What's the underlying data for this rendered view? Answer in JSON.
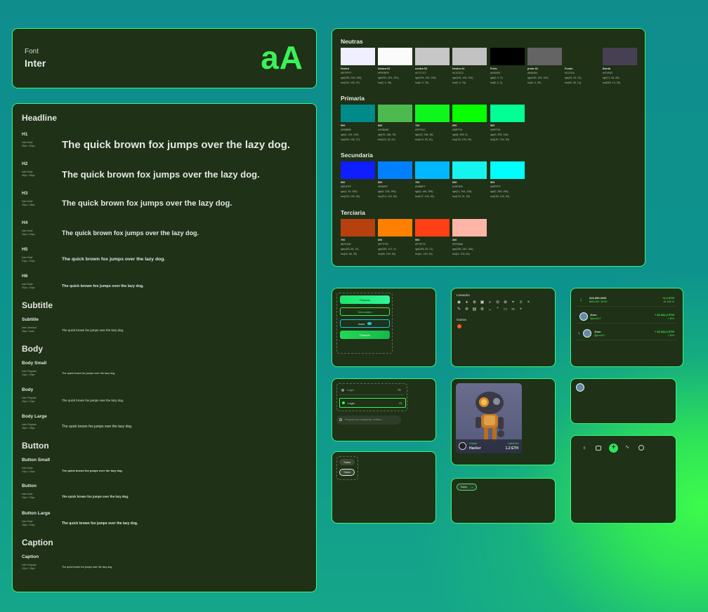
{
  "font_card": {
    "label": "Font",
    "name": "Inter",
    "sample": "aA"
  },
  "typography": {
    "headline": {
      "title": "Headline",
      "items": [
        {
          "name": "H1",
          "meta1": "Inter Bold",
          "meta2": "56px / 64px",
          "sample": "The quick brown fox jumps over the lazy dog."
        },
        {
          "name": "H2",
          "meta1": "Inter Bold",
          "meta2": "48px / 56px",
          "sample": "The quick brown fox jumps over the lazy dog."
        },
        {
          "name": "H3",
          "meta1": "Inter Bold",
          "meta2": "40px / 48px",
          "sample": "The quick brown fox jumps over the lazy dog."
        },
        {
          "name": "H4",
          "meta1": "Inter Bold",
          "meta2": "32px / 40px",
          "sample": "The quick brown fox jumps over the lazy dog."
        },
        {
          "name": "H5",
          "meta1": "Inter Bold",
          "meta2": "24px / 32px",
          "sample": "The quick brown fox jumps over the lazy dog."
        },
        {
          "name": "H6",
          "meta1": "Inter Bold",
          "meta2": "20px / 24px",
          "sample": "The quick brown fox jumps over the lazy dog."
        }
      ]
    },
    "subtitle": {
      "title": "Subtitle",
      "items": [
        {
          "name": "Subtitle",
          "meta1": "Inter Medium",
          "meta2": "16px / auto",
          "sample": "The quick brown fox jumps over the lazy dog."
        }
      ]
    },
    "body": {
      "title": "Body",
      "items": [
        {
          "name": "Body Small",
          "meta1": "Inter Regular",
          "meta2": "14px / 20px",
          "sample": "The quick brown fox jumps over the lazy dog."
        },
        {
          "name": "Body",
          "meta1": "Inter Regular",
          "meta2": "16px / 24px",
          "sample": "The quick brown fox jumps over the lazy dog."
        },
        {
          "name": "Body Large",
          "meta1": "Inter Regular",
          "meta2": "18px / 28px",
          "sample": "The quick brown fox jumps over the lazy dog."
        }
      ]
    },
    "button": {
      "title": "Button",
      "items": [
        {
          "name": "Button Small",
          "meta1": "Inter Bold",
          "meta2": "14px / 18px",
          "sample": "The quick brown fox jumps over the lazy dog."
        },
        {
          "name": "Button",
          "meta1": "Inter Bold",
          "meta2": "16px / 20px",
          "sample": "The quick brown fox jumps over the lazy dog."
        },
        {
          "name": "Button Large",
          "meta1": "Inter Bold",
          "meta2": "18px / 24px",
          "sample": "The quick brown fox jumps over the lazy dog."
        }
      ]
    },
    "caption": {
      "title": "Caption",
      "items": [
        {
          "name": "Caption",
          "meta1": "Inter Regular",
          "meta2": "12px / 16px",
          "sample": "The quick brown fox jumps over the lazy dog."
        }
      ]
    }
  },
  "colors": {
    "neutras": {
      "title": "Neutras",
      "swatches": [
        {
          "name": "Neutra",
          "hex": "#EFEFFF",
          "rgb": "rgb(239, 239, 255)",
          "hsl": "hsl(240, 100, 97)",
          "color": "#efefff"
        },
        {
          "name": "Neutra 02",
          "hex": "#FBFBFB",
          "rgb": "rgb(251, 251, 251)",
          "hsl": "hsl(0, 0, 98)",
          "color": "#fbfbfb"
        },
        {
          "name": "neutra 03",
          "hex": "#C7C7C7",
          "rgb": "rgb(199, 199, 199)",
          "hsl": "hsl(0, 0, 78)",
          "color": "#c7c7c7"
        },
        {
          "name": "Neutra 04",
          "hex": "#C2C2C2",
          "rgb": "rgb(194, 194, 194)",
          "hsl": "hsl(0, 0, 76)",
          "color": "#c2c2c2"
        },
        {
          "name": "Preto",
          "hex": "#000000",
          "rgb": "rgb(0, 0, 0)",
          "hsl": "hsl(0, 0, 0)",
          "color": "#000000"
        },
        {
          "name": "preto 02",
          "hex": "#646464",
          "rgb": "rgb(100, 100, 100)",
          "hsl": "hsl(0, 0, 39)",
          "color": "#646464"
        },
        {
          "name": "Fundo",
          "hex": "#213116",
          "rgb": "rgb(33, 49, 22)",
          "hsl": "hsl(96, 38, 14)",
          "color": "#213116"
        },
        {
          "name": "Borda",
          "hex": "#474053",
          "rgb": "rgb(71, 64, 83)",
          "hsl": "hsl(262, 13, 29)",
          "color": "#474053"
        }
      ]
    },
    "primaria": {
      "title": "Primaria",
      "swatches": [
        {
          "name": "900",
          "hex": "#008B8B",
          "rgb": "rgb(0, 139, 139)",
          "hsl": "hsl(180, 100, 27)",
          "color": "#008b8b"
        },
        {
          "name": "800",
          "hex": "#4CBA4E",
          "rgb": "rgb(76, 186, 78)",
          "hsl": "hsl(119, 45, 51)",
          "color": "#4cba4e"
        },
        {
          "name": "700",
          "hex": "#0FF61C",
          "rgb": "rgb(15, 246, 28)",
          "hsl": "hsl(124, 93, 51)",
          "color": "#0ff61c"
        },
        {
          "name": "600",
          "hex": "#08FF00",
          "rgb": "rgb(8, 255, 0)",
          "hsl": "hsl(120, 100, 50)",
          "color": "#08ff00"
        },
        {
          "name": "500",
          "hex": "#00FF94",
          "rgb": "rgb(0, 255, 148)",
          "hsl": "hsl(157, 100, 50)",
          "color": "#00ff94"
        }
      ]
    },
    "secundaria": {
      "title": "Secundaria",
      "swatches": [
        {
          "name": "900",
          "hex": "#0E1EFF",
          "rgb": "rgb(0, 30, 255)",
          "hsl": "hsl(233, 100, 50)",
          "color": "#0e1eff"
        },
        {
          "name": "800",
          "hex": "#0080FF",
          "rgb": "rgb(0, 128, 255)",
          "hsl": "hsl(210, 100, 50)",
          "color": "#0080ff"
        },
        {
          "name": "700",
          "hex": "#00B8FF",
          "rgb": "rgb(0, 184, 255)",
          "hsl": "hsl(197, 100, 50)",
          "color": "#00b8ff"
        },
        {
          "name": "600",
          "hex": "#15F4EE",
          "rgb": "rgb(21, 244, 238)",
          "hsl": "hsl(178, 91, 52)",
          "color": "#15f4ee"
        },
        {
          "name": "500",
          "hex": "#00FFFF",
          "rgb": "rgb(0, 255, 255)",
          "hsl": "hsl(180, 100, 50)",
          "color": "#00ffff"
        }
      ]
    },
    "terciaria": {
      "title": "Terciaria",
      "swatches": [
        {
          "name": "700",
          "hex": "#B7410E",
          "rgb": "rgb(183, 65, 14)",
          "hsl": "hsl(18, 86, 39)",
          "color": "#b7410e"
        },
        {
          "name": "600",
          "hex": "#FF7F00",
          "rgb": "rgb(255, 127, 0)",
          "hsl": "hsl(30, 100, 50)",
          "color": "#ff7f00"
        },
        {
          "name": "500",
          "hex": "#FF3F15",
          "rgb": "rgb(255, 63, 21)",
          "hsl": "hsl(11, 100, 54)",
          "color": "#ff3f15"
        },
        {
          "name": "400",
          "hex": "#FFB6A6",
          "rgb": "rgb(255, 182, 166)",
          "hsl": "hsl(11, 100, 83)",
          "color": "#ffb6a6"
        }
      ]
    }
  },
  "buttons": {
    "primary": "Primário",
    "secondary": "Secundário",
    "icons": "Icons",
    "primary2": "Primário"
  },
  "icons_card": {
    "lineados": "Lineados",
    "outros": "Outros"
  },
  "inputs": {
    "login1": "Login",
    "login2": "Login",
    "search_placeholder": "Pesquise por categorias, artistas..."
  },
  "wallet": {
    "row1": {
      "value": "643.859.0030",
      "sub": "$600,000 / $10%",
      "eth": "+1.2 ETH",
      "eth_sub": "$1,345.00"
    },
    "row2": {
      "name": "Jhon",
      "handle": "@jhon017",
      "eth": "+ 32.322,2 ETH",
      "pct": "+ 30%"
    },
    "row3": {
      "rank": "1",
      "name": "Jhon",
      "handle": "@jhon017",
      "eth": "+ 32.322,2 ETH",
      "pct": "+ 30%"
    }
  },
  "nft": {
    "tag": "Creator",
    "name": "Hacker",
    "price_label": "Latest bid",
    "price": "1.2 ETH"
  },
  "chips": {
    "todos1": "Todos",
    "todos2": "Todos",
    "dropdown": "Todos"
  }
}
